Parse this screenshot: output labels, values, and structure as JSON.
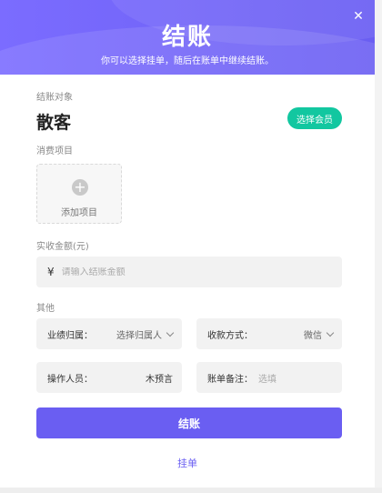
{
  "header": {
    "title": "结账",
    "subtitle": "你可以选择挂单，随后在账单中继续结账。",
    "close_glyph": "✕"
  },
  "customer_section": {
    "label": "结账对象",
    "customer_name": "散客",
    "select_member_label": "选择会员"
  },
  "items_section": {
    "label": "消费项目",
    "add_item_label": "添加项目"
  },
  "amount_section": {
    "label": "实收金额(元)",
    "currency_symbol": "¥",
    "placeholder": "请输入结账金额"
  },
  "other_section": {
    "label": "其他",
    "performance_owner": {
      "label": "业绩归属：",
      "value": "选择归属人"
    },
    "payment_method": {
      "label": "收款方式：",
      "value": "微信"
    },
    "operator": {
      "label": "操作人员：",
      "value": "木预言"
    },
    "bill_note": {
      "label": "账单备注：",
      "placeholder": "选填"
    }
  },
  "actions": {
    "checkout_label": "结账",
    "hang_label": "挂单"
  },
  "colors": {
    "primary": "#6a5ef2",
    "member_button": "#12c7a0"
  }
}
